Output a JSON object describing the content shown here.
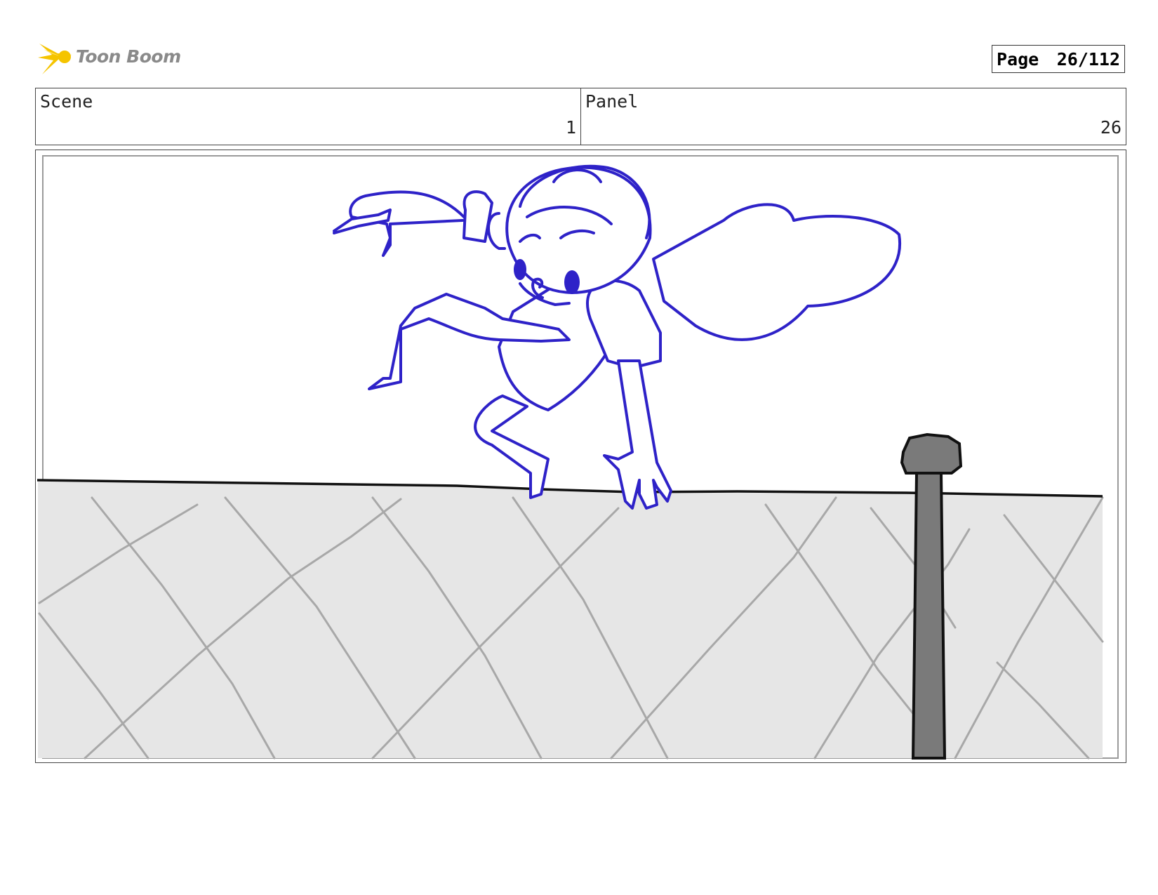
{
  "header": {
    "logo_text": "Toon Boom",
    "page_label": "Page",
    "page_value": "26/112"
  },
  "info": {
    "scene_label": "Scene",
    "scene_value": "1",
    "panel_label": "Panel",
    "panel_value": "26"
  },
  "colors": {
    "character_line": "#2e22c8",
    "fence_fill": "#e6e6e6",
    "fence_wire": "#a8a8a8",
    "post_fill": "#7a7a7a",
    "logo_accent": "#f5c400"
  }
}
